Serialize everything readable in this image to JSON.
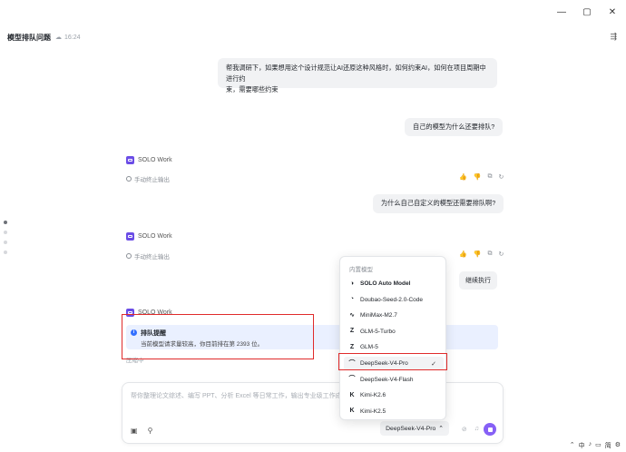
{
  "window": {
    "controls": [
      "—",
      "▢",
      "✕"
    ]
  },
  "header": {
    "title": "模型排队问题",
    "time": "16:24"
  },
  "messages": {
    "user1_line1": "帮我调研下，如果想用这个设计规范让AI还原这种风格时，如何约束AI，如何在项目周期中进行约",
    "user1_line2": "束，需要哪些约束",
    "user2": "自己的模型为什么还要排队?",
    "user3": "为什么自己自定义的模型还需要排队啊?",
    "agent_name": "SOLO Work",
    "stopped": "手动终止输出",
    "continue_btn": "继续执行",
    "partial_label": "压缩中"
  },
  "notice": {
    "title": "排队提醒",
    "desc": "当前模型请求量较高，你目前排在第 2393 位。"
  },
  "composer": {
    "placeholder": "帮你整理论文综述、编写 PPT、分析 Excel 等日常工作，输出专业级工作成果。",
    "model_label": "DeepSeek-V4-Pro",
    "model_caret": "⌃"
  },
  "dropdown": {
    "header": "内置模型",
    "items": [
      {
        "label": "SOLO Auto Model",
        "icon": "solo-auto-icon",
        "glyph": "◑"
      },
      {
        "label": "Doubao-Seed-2.0-Code",
        "icon": "doubao-icon",
        "glyph": "◔"
      },
      {
        "label": "MiniMax-M2.7",
        "icon": "minimax-icon",
        "glyph": "∿"
      },
      {
        "label": "GLM-5-Turbo",
        "icon": "glm-icon",
        "glyph": "Z"
      },
      {
        "label": "GLM-5",
        "icon": "glm-icon",
        "glyph": "Z"
      },
      {
        "label": "DeepSeek-V4-Pro",
        "icon": "deepseek-icon",
        "glyph": "⌒"
      },
      {
        "label": "DeepSeek-V4-Flash",
        "icon": "deepseek-icon",
        "glyph": "⌒"
      },
      {
        "label": "Kimi-K2.6",
        "icon": "kimi-icon",
        "glyph": "K"
      },
      {
        "label": "Kimi-K2.5",
        "icon": "kimi-icon",
        "glyph": "K"
      }
    ],
    "selected": "DeepSeek-V4-Pro",
    "check": "✓"
  },
  "taskbar": {
    "items": [
      "⌃",
      "中",
      "♪",
      "▭",
      "简",
      "⚙"
    ]
  },
  "colors": {
    "accent": "#8660f6",
    "highlight_box": "#e02b2b",
    "notice_bg": "#eaf0ff",
    "bubble_bg": "#f1f2f4"
  }
}
